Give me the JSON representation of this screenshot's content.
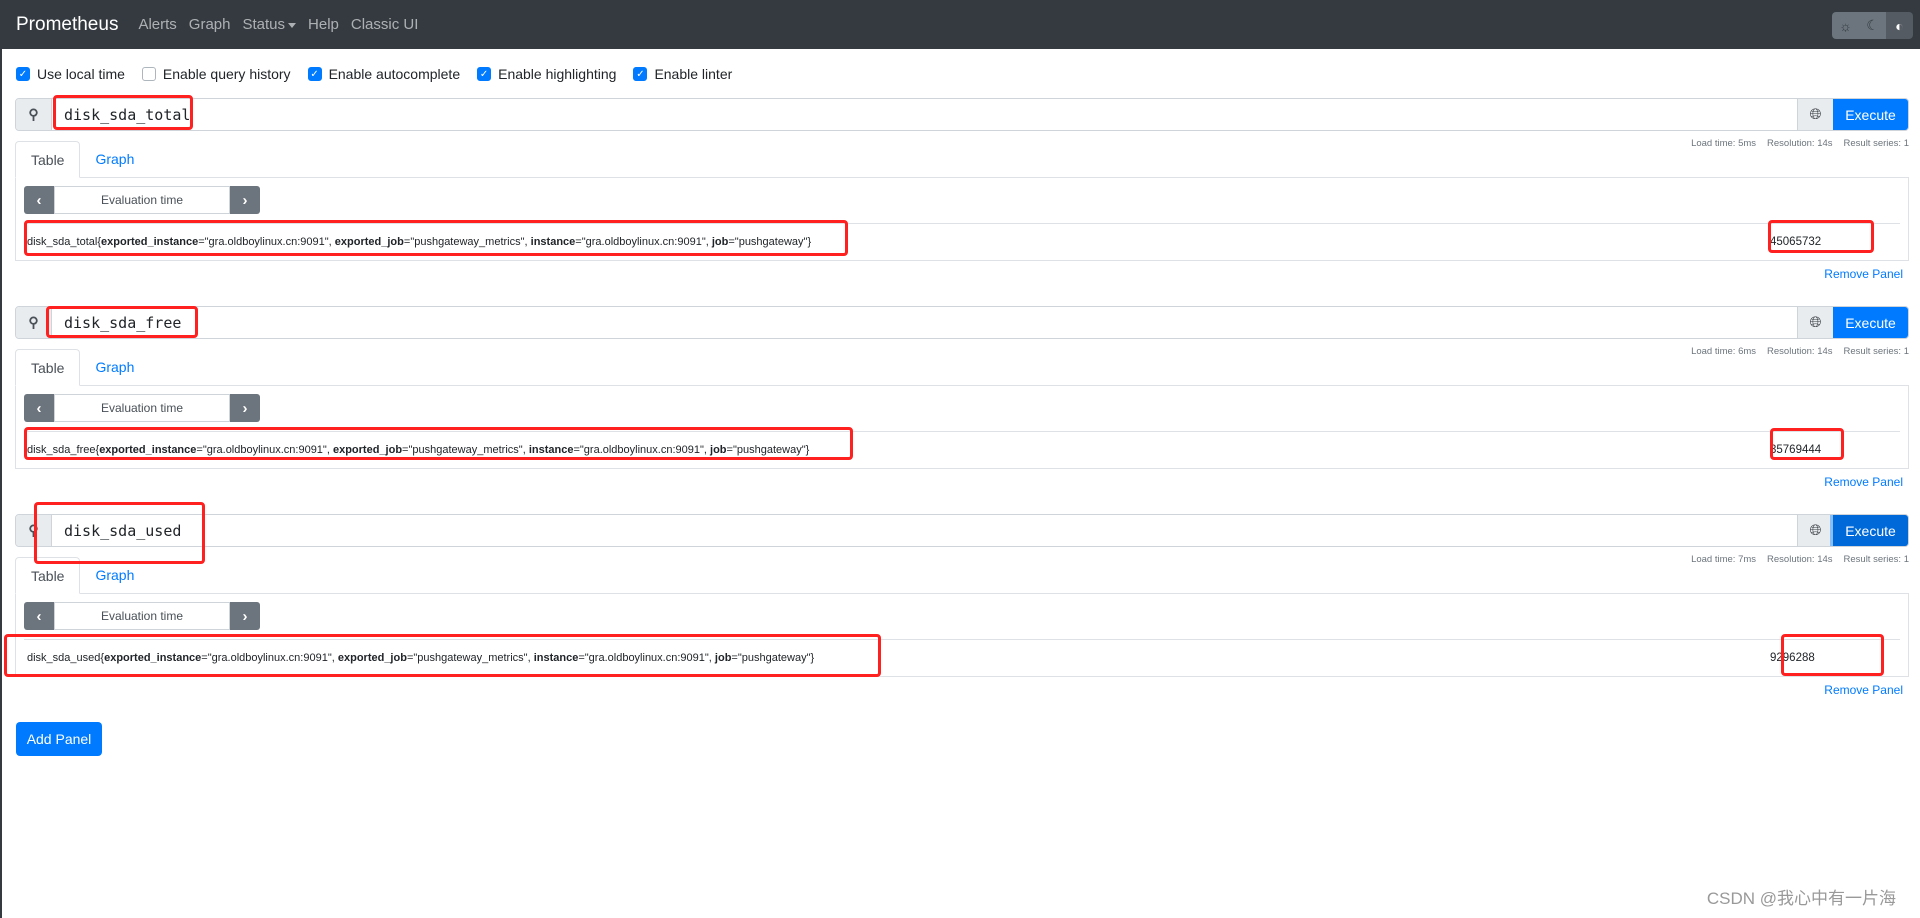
{
  "nav": {
    "brand": "Prometheus",
    "links": [
      "Alerts",
      "Graph",
      "Status",
      "Help",
      "Classic UI"
    ],
    "theme_icons": [
      "sun-icon",
      "moon-icon",
      "contrast-icon"
    ]
  },
  "options": [
    {
      "label": "Use local time",
      "checked": true
    },
    {
      "label": "Enable query history",
      "checked": false
    },
    {
      "label": "Enable autocomplete",
      "checked": true
    },
    {
      "label": "Enable highlighting",
      "checked": true
    },
    {
      "label": "Enable linter",
      "checked": true
    }
  ],
  "panels": [
    {
      "query": "disk_sda_total",
      "execute": "Execute",
      "tabs": [
        "Table",
        "Graph"
      ],
      "stats": {
        "load": "Load time: 5ms",
        "resolution": "Resolution: 14s",
        "series": "Result series: 1"
      },
      "eval_time": "Evaluation time",
      "metric": "disk_sda_total",
      "labels": [
        {
          "k": "exported_instance",
          "v": "\"gra.oldboylinux.cn:9091\""
        },
        {
          "k": "exported_job",
          "v": "\"pushgateway_metrics\""
        },
        {
          "k": "instance",
          "v": "\"gra.oldboylinux.cn:9091\""
        },
        {
          "k": "job",
          "v": "\"pushgateway\""
        }
      ],
      "value": "45065732",
      "remove": "Remove Panel"
    },
    {
      "query": "disk_sda_free",
      "execute": "Execute",
      "tabs": [
        "Table",
        "Graph"
      ],
      "stats": {
        "load": "Load time: 6ms",
        "resolution": "Resolution: 14s",
        "series": "Result series: 1"
      },
      "eval_time": "Evaluation time",
      "metric": "disk_sda_free",
      "labels": [
        {
          "k": "exported_instance",
          "v": "\"gra.oldboylinux.cn:9091\""
        },
        {
          "k": "exported_job",
          "v": "\"pushgateway_metrics\""
        },
        {
          "k": "instance",
          "v": "\"gra.oldboylinux.cn:9091\""
        },
        {
          "k": "job",
          "v": "\"pushgateway\""
        }
      ],
      "value": "35769444",
      "remove": "Remove Panel"
    },
    {
      "query": "disk_sda_used",
      "execute": "Execute",
      "tabs": [
        "Table",
        "Graph"
      ],
      "stats": {
        "load": "Load time: 7ms",
        "resolution": "Resolution: 14s",
        "series": "Result series: 1"
      },
      "eval_time": "Evaluation time",
      "metric": "disk_sda_used",
      "labels": [
        {
          "k": "exported_instance",
          "v": "\"gra.oldboylinux.cn:9091\""
        },
        {
          "k": "exported_job",
          "v": "\"pushgateway_metrics\""
        },
        {
          "k": "instance",
          "v": "\"gra.oldboylinux.cn:9091\""
        },
        {
          "k": "job",
          "v": "\"pushgateway\""
        }
      ],
      "value": "9296288",
      "remove": "Remove Panel"
    }
  ],
  "add_panel": "Add Panel",
  "watermark": "CSDN @我心中有一片海",
  "colors": {
    "navbar": "#343a40",
    "primary": "#007bff",
    "annotation": "#ff2020"
  }
}
